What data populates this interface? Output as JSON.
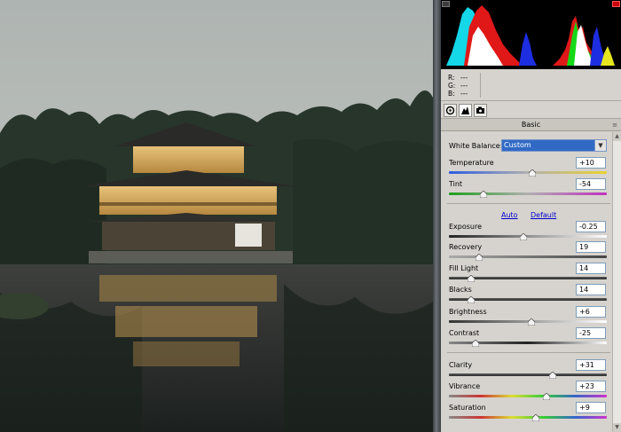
{
  "rgb_readout": [
    {
      "label": "R:",
      "value": "---"
    },
    {
      "label": "G:",
      "value": "---"
    },
    {
      "label": "B:",
      "value": "---"
    }
  ],
  "tool_tabs": [
    {
      "icon": "basic-adjust-icon",
      "active": false
    },
    {
      "icon": "tone-curve-icon",
      "active": true
    },
    {
      "icon": "camera-calibration-icon",
      "active": false
    }
  ],
  "section_title": "Basic",
  "white_balance": {
    "label": "White Balance:",
    "selected": "Custom"
  },
  "links": {
    "auto": "Auto",
    "default": "Default"
  },
  "controls": [
    {
      "label": "Temperature",
      "value": "+10",
      "level": 0.53,
      "track": "temp"
    },
    {
      "label": "Tint",
      "value": "-54",
      "level": 0.22,
      "track": "tint"
    },
    {
      "label": "Exposure",
      "value": "-0.25",
      "level": 0.47,
      "track": "exposure"
    },
    {
      "label": "Recovery",
      "value": "19",
      "level": 0.19,
      "track": "recovery"
    },
    {
      "label": "Fill Light",
      "value": "14",
      "level": 0.14,
      "track": "neutral"
    },
    {
      "label": "Blacks",
      "value": "14",
      "level": 0.14,
      "track": "neutral"
    },
    {
      "label": "Brightness",
      "value": "+6",
      "level": 0.52,
      "track": "brightness"
    },
    {
      "label": "Contrast",
      "value": "-25",
      "level": 0.17,
      "track": "contrast"
    },
    {
      "label": "Clarity",
      "value": "+31",
      "level": 0.66,
      "track": "neutral"
    },
    {
      "label": "Vibrance",
      "value": "+23",
      "level": 0.62,
      "track": "vibrance"
    },
    {
      "label": "Saturation",
      "value": "+9",
      "level": 0.55,
      "track": "saturation"
    }
  ],
  "colors": {
    "panel_bg": "#d6d3ce",
    "select_highlight": "#316ac5",
    "link": "#0000cc"
  }
}
